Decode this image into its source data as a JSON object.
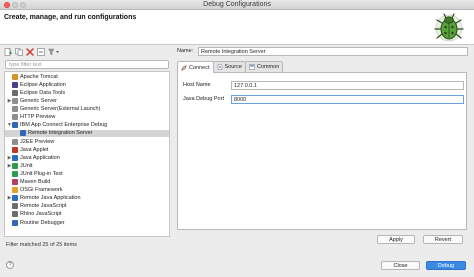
{
  "window": {
    "title": "Debug Configurations"
  },
  "header": {
    "title": "Create, manage, and run configurations"
  },
  "filter": {
    "placeholder": "type filter text"
  },
  "tree": [
    {
      "label": "Apache Tomcat",
      "arrow": "",
      "icon": "tomcat-icon",
      "color": "#d9912b"
    },
    {
      "label": "Eclipse Application",
      "arrow": "",
      "icon": "eclipse-icon",
      "color": "#4a3e8f"
    },
    {
      "label": "Eclipse Data Tools",
      "arrow": "",
      "icon": "data-tools-icon",
      "color": "#6b6b6b"
    },
    {
      "label": "Generic Server",
      "arrow": "▶",
      "icon": "server-icon",
      "color": "#8f8f8f"
    },
    {
      "label": "Generic Server(External Launch)",
      "arrow": "",
      "icon": "server-icon",
      "color": "#8f8f8f"
    },
    {
      "label": "HTTP Preview",
      "arrow": "",
      "icon": "http-icon",
      "color": "#8f8f8f"
    },
    {
      "label": "IBM App Connect Enterprise Debug",
      "arrow": "▼",
      "icon": "ace-debug-icon",
      "color": "#3367b5"
    },
    {
      "label": "Remote Integration Server",
      "arrow": "",
      "icon": "ace-debug-icon",
      "color": "#3367b5",
      "indent": 1,
      "selected": true
    },
    {
      "label": "J2EE Preview",
      "arrow": "",
      "icon": "j2ee-icon",
      "color": "#8f8f8f"
    },
    {
      "label": "Java Applet",
      "arrow": "",
      "icon": "java-applet-icon",
      "color": "#c0392b"
    },
    {
      "label": "Java Application",
      "arrow": "▶",
      "icon": "java-app-icon",
      "color": "#2c6fbf"
    },
    {
      "label": "JUnit",
      "arrow": "▶",
      "icon": "junit-icon",
      "color": "#2c9d4e"
    },
    {
      "label": "JUnit Plug-in Test",
      "arrow": "",
      "icon": "junit-plugin-icon",
      "color": "#2c9d4e"
    },
    {
      "label": "Maven Build",
      "arrow": "",
      "icon": "maven-icon",
      "color": "#b83d63"
    },
    {
      "label": "OSGi Framework",
      "arrow": "",
      "icon": "osgi-icon",
      "color": "#e2a126"
    },
    {
      "label": "Remote Java Application",
      "arrow": "▶",
      "icon": "remote-java-icon",
      "color": "#2c6fbf"
    },
    {
      "label": "Remote JavaScript",
      "arrow": "",
      "icon": "remote-js-icon",
      "color": "#6d6d6d"
    },
    {
      "label": "Rhino JavaScript",
      "arrow": "",
      "icon": "rhino-icon",
      "color": "#6d6d6d"
    },
    {
      "label": "Routine Debugger",
      "arrow": "",
      "icon": "routine-debugger-icon",
      "color": "#3367b5"
    }
  ],
  "status": {
    "text": "Filter matched 25 of 25 items"
  },
  "config": {
    "name_label": "Name:",
    "name_value": "Remote Integration Server",
    "tabs": [
      {
        "label": "Connect",
        "icon": "connect-icon",
        "active": true
      },
      {
        "label": "Source",
        "icon": "source-icon",
        "active": false
      },
      {
        "label": "Common",
        "icon": "common-icon",
        "active": false
      }
    ],
    "host_label": "Host Name",
    "host_value": "127.0.0.1",
    "port_label": "Java Debug Port",
    "port_value": "8000"
  },
  "buttons": {
    "apply": "Apply",
    "revert": "Revert",
    "close": "Close",
    "debug": "Debug",
    "help": "?"
  },
  "colors": {
    "accent": "#3a89e3",
    "selection": "#d4d4d4"
  }
}
